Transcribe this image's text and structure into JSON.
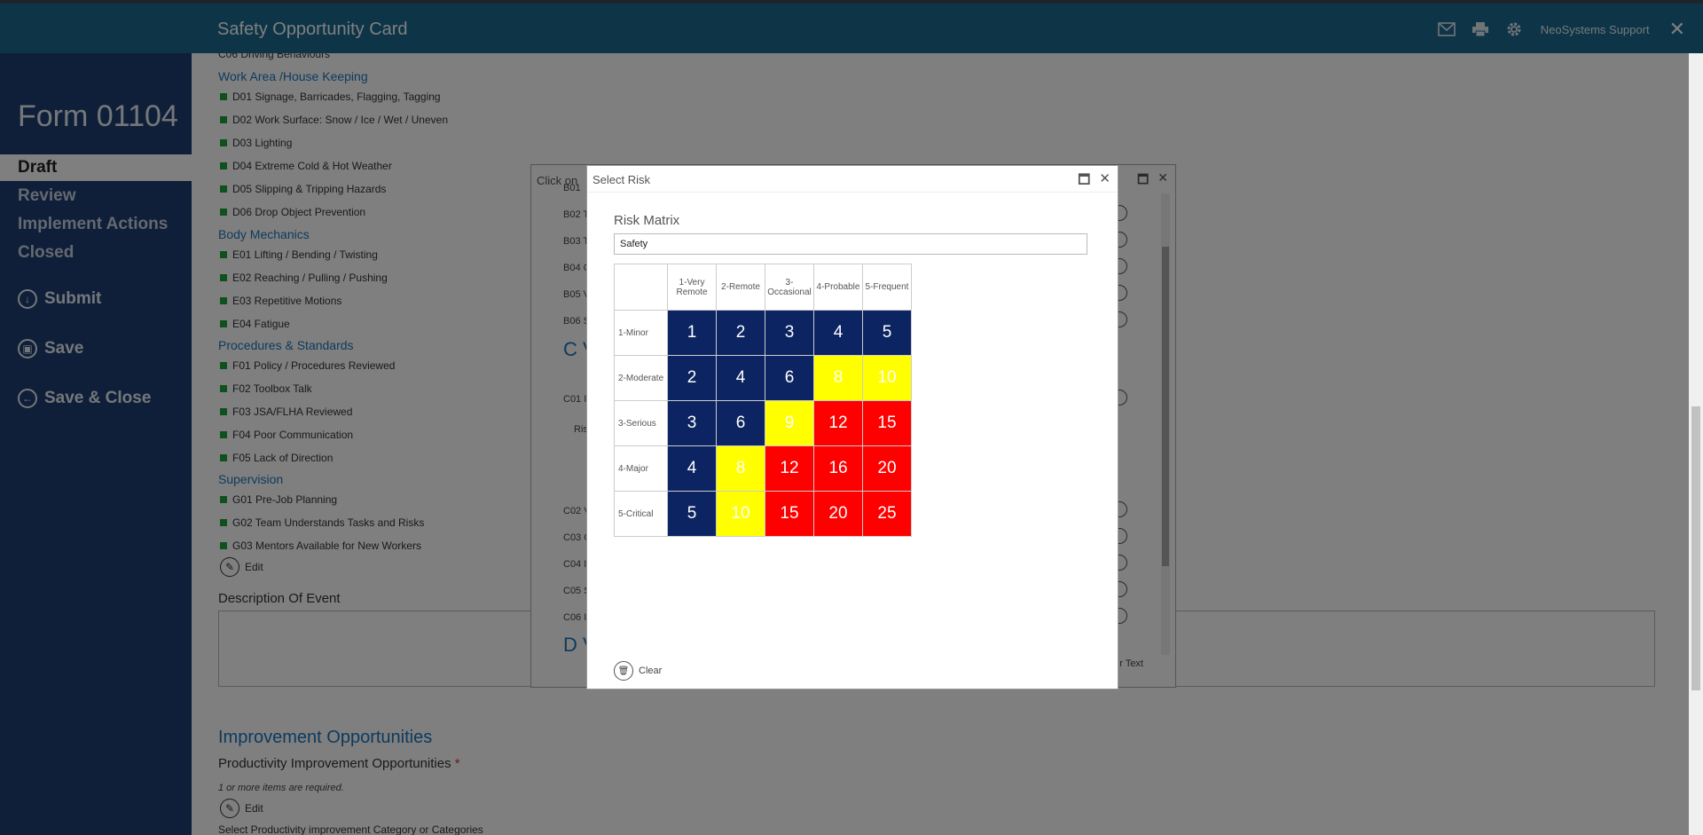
{
  "app": {
    "title": "Safety Opportunity Card",
    "user": "NeoSystems Support"
  },
  "sidebar": {
    "form_number": "Form 01104",
    "stages": [
      "Draft",
      "Review",
      "Implement Actions",
      "Closed"
    ],
    "actions": [
      {
        "label": "Submit",
        "icon": "submit-icon"
      },
      {
        "label": "Save",
        "icon": "save-icon"
      },
      {
        "label": "Save & Close",
        "icon": "save-close-icon"
      }
    ]
  },
  "main": {
    "cut_top": "C06 Driving Behaviours",
    "sections": [
      {
        "title": "Work Area /House Keeping",
        "items": [
          "D01 Signage, Barricades, Flagging, Tagging",
          "D02 Work Surface: Snow / Ice / Wet / Uneven",
          "D03 Lighting",
          "D04 Extreme Cold & Hot Weather",
          "D05 Slipping & Tripping Hazards",
          "D06 Drop Object Prevention"
        ]
      },
      {
        "title": "Body Mechanics",
        "items": [
          "E01 Lifting / Bending / Twisting",
          "E02 Reaching / Pulling / Pushing",
          "E03 Repetitive Motions",
          "E04 Fatigue"
        ]
      },
      {
        "title": "Procedures & Standards",
        "items": [
          "F01 Policy / Procedures Reviewed",
          "F02 Toolbox Talk",
          "F03 JSA/FLHA Reviewed",
          "F04 Poor Communication",
          "F05 Lack of Direction"
        ]
      },
      {
        "title": "Supervision",
        "items": [
          "G01 Pre-Job Planning",
          "G02 Team Understands Tasks and Risks",
          "G03 Mentors Available for New Workers"
        ]
      }
    ],
    "edit_label": "Edit",
    "description_label": "Description Of Event",
    "improvement_title": "Improvement Opportunities",
    "productivity_label": "Productivity Improvement Opportunities",
    "required_mark": "*",
    "required_note": "1 or more items are required.",
    "edit_label_2": "Edit",
    "cut_bottom": "Select Productivity improvement Category or Categories"
  },
  "bg_dialog": {
    "header": "Click on",
    "codes": [
      "B01",
      "B02 T",
      "B03 T",
      "B04 C",
      "B05 V",
      "B06 S",
      "C01 I",
      "Ris",
      "C02 V",
      "C03 C",
      "C04 I",
      "C05 S",
      "C06 I"
    ],
    "section_c": "C V",
    "section_d": "D V",
    "text_fragment": "r Text"
  },
  "modal": {
    "title": "Select Risk",
    "risk_matrix_label": "Risk Matrix",
    "risk_matrix_value": "Safety",
    "columns": [
      "1-Very Remote",
      "2-Remote",
      "3-Occasional",
      "4-Probable",
      "5-Frequent"
    ],
    "rows": [
      {
        "label": "1-Minor",
        "values": [
          "1",
          "2",
          "3",
          "4",
          "5"
        ],
        "levels": [
          "low",
          "low",
          "low",
          "low",
          "low"
        ]
      },
      {
        "label": "2-Moderate",
        "values": [
          "2",
          "4",
          "6",
          "8",
          "10"
        ],
        "levels": [
          "low",
          "low",
          "low",
          "medium",
          "medium"
        ]
      },
      {
        "label": "3-Serious",
        "values": [
          "3",
          "6",
          "9",
          "12",
          "15"
        ],
        "levels": [
          "low",
          "low",
          "medium",
          "high",
          "high"
        ]
      },
      {
        "label": "4-Major",
        "values": [
          "4",
          "8",
          "12",
          "16",
          "20"
        ],
        "levels": [
          "low",
          "medium",
          "high",
          "high",
          "high"
        ]
      },
      {
        "label": "5-Critical",
        "values": [
          "5",
          "10",
          "15",
          "20",
          "25"
        ],
        "levels": [
          "low",
          "medium",
          "high",
          "high",
          "high"
        ]
      }
    ],
    "clear_label": "Clear"
  },
  "colors": {
    "low": "#0c2461",
    "medium": "#ffff00",
    "high": "#ff0000",
    "accent": "#1b75bb",
    "topbar": "#1a6a8f",
    "sidebar": "#1e3f73"
  }
}
